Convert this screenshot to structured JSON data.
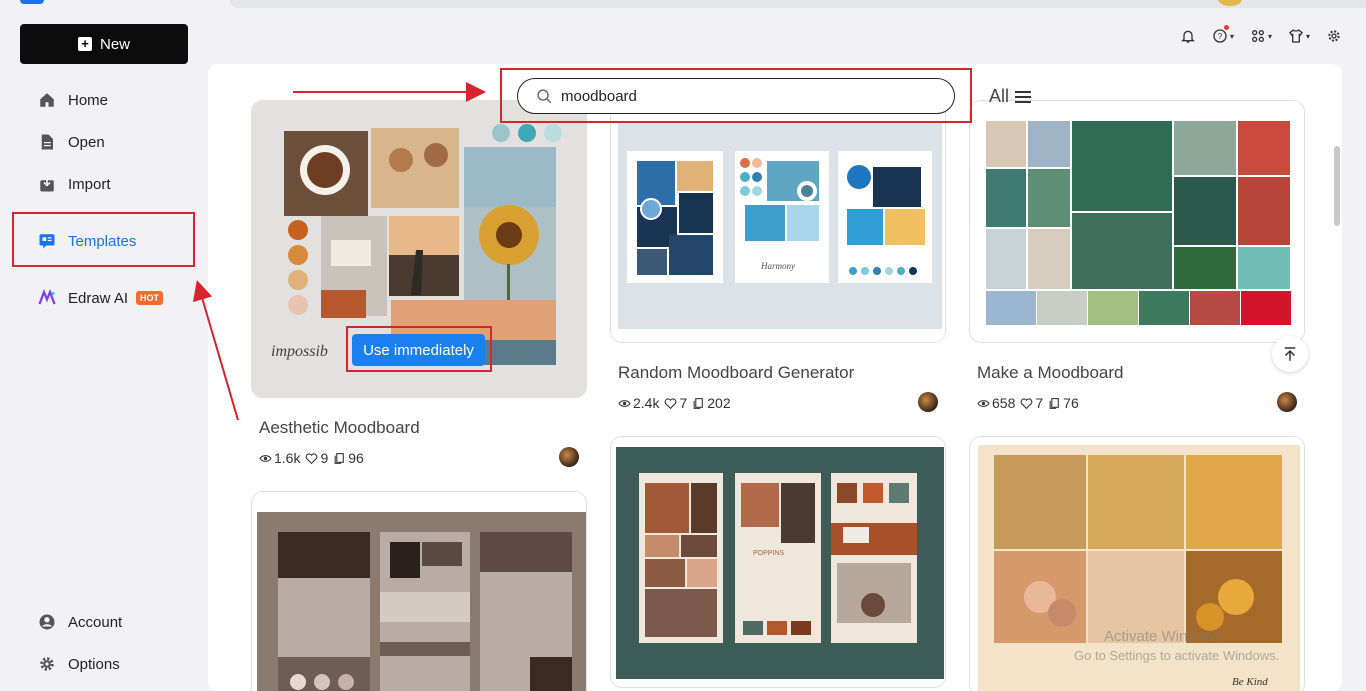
{
  "sidebar": {
    "new_label": "New",
    "items": [
      {
        "label": "Home",
        "icon": "home-icon"
      },
      {
        "label": "Open",
        "icon": "file-icon"
      },
      {
        "label": "Import",
        "icon": "import-icon"
      },
      {
        "label": "Templates",
        "icon": "templates-icon"
      },
      {
        "label": "Edraw AI",
        "icon": "ai-icon",
        "badge": "HOT"
      }
    ],
    "bottom": [
      {
        "label": "Account",
        "icon": "account-icon"
      },
      {
        "label": "Options",
        "icon": "gear-icon"
      }
    ]
  },
  "search": {
    "value": "moodboard",
    "filter_label": "All"
  },
  "cards": [
    {
      "title": "Aesthetic Moodboard",
      "views": "1.6k",
      "likes": "9",
      "copies": "96",
      "cta": "Use immediately"
    },
    {
      "title": "Random Moodboard Generator",
      "views": "2.4k",
      "likes": "7",
      "copies": "202"
    },
    {
      "title": "Make a Moodboard",
      "views": "658",
      "likes": "7",
      "copies": "76"
    }
  ],
  "watermark": {
    "line1": "Activate Windows",
    "line2": "Go to Settings to activate Windows."
  },
  "colors": {
    "accent": "#1a73e8",
    "highlight": "#d9232d",
    "hot": "#ff6a2c"
  }
}
